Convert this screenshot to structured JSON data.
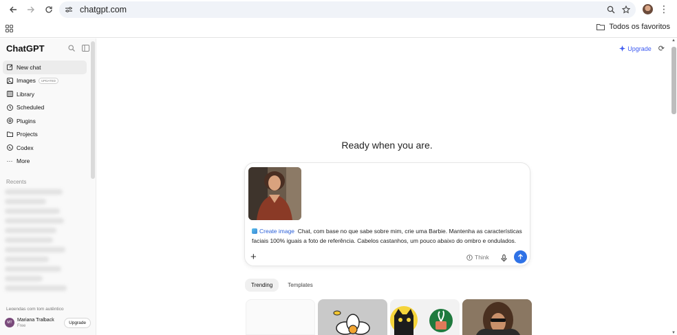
{
  "browser": {
    "url": "chatgpt.com",
    "bookmark_folder": "Todos os favoritos"
  },
  "sidebar": {
    "brand": "ChatGPT",
    "items": [
      {
        "label": "New chat",
        "icon": "pencil-icon"
      },
      {
        "label": "Images",
        "icon": "images-icon",
        "badge": "UPDATED"
      },
      {
        "label": "Library",
        "icon": "library-icon"
      },
      {
        "label": "Scheduled",
        "icon": "clock-icon"
      },
      {
        "label": "Plugins",
        "icon": "plugin-icon"
      },
      {
        "label": "Projects",
        "icon": "folder-icon"
      },
      {
        "label": "Codex",
        "icon": "codex-icon"
      },
      {
        "label": "More",
        "icon": "more-icon"
      }
    ],
    "recents_label": "Recents",
    "last_recent": "Legendas com tom autêntico",
    "user": {
      "initials": "MT",
      "name": "Mariana Tralback",
      "plan": "Free",
      "upgrade": "Upgrade"
    }
  },
  "main": {
    "upgrade": "Upgrade",
    "headline": "Ready when you are.",
    "composer": {
      "tag": "Create image",
      "text": "Chat, com base no que sabe sobre mim, crie uma Barbie. Mantenha as características faciais 100% iguais a foto de referência. Cabelos castanhos, um pouco abaixo do ombro e ondulados.",
      "think": "Think"
    },
    "tabs": [
      "Trending",
      "Templates"
    ]
  },
  "colors": {
    "accent": "#2f72e6",
    "sidebar_bg": "#f9f9f9"
  }
}
